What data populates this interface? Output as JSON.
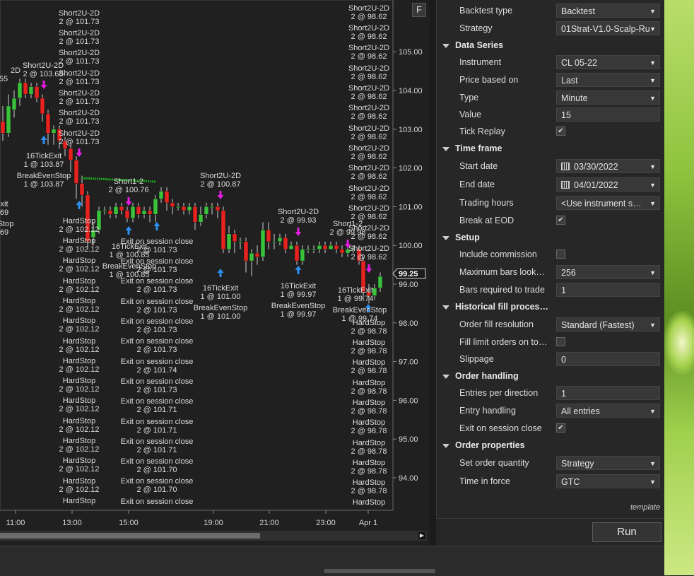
{
  "chart": {
    "button_f": "F",
    "y_ticks": [
      "105.00",
      "104.00",
      "103.00",
      "102.00",
      "101.00",
      "100.00",
      "99.00",
      "98.00",
      "97.00",
      "96.00",
      "95.00",
      "94.00"
    ],
    "x_ticks": [
      "11:00",
      "13:00",
      "15:00",
      "19:00",
      "21:00",
      "23:00",
      "Apr 1"
    ],
    "price_marker": "99.25",
    "annotations": [
      {
        "t": "2D",
        "x": 22,
        "y": 103
      },
      {
        "t": "55",
        "x": 5,
        "y": 115
      },
      {
        "t": "Short2U-2D",
        "x": 61,
        "y": 96
      },
      {
        "t": "2 @ 103.68",
        "x": 61,
        "y": 108
      },
      {
        "t": "16TickExit",
        "x": 62,
        "y": 224
      },
      {
        "t": "1 @ 103.87",
        "x": 62,
        "y": 236
      },
      {
        "t": "BreakEvenStop",
        "x": 62,
        "y": 252
      },
      {
        "t": "1 @ 103.87",
        "x": 62,
        "y": 264
      },
      {
        "t": "xit",
        "x": 6,
        "y": 292
      },
      {
        "t": "69",
        "x": 6,
        "y": 304
      },
      {
        "t": "Stop",
        "x": 8,
        "y": 320
      },
      {
        "t": "69",
        "x": 6,
        "y": 332
      },
      {
        "t": "Short2U-2D",
        "x": 112,
        "y": 22
      },
      {
        "t": "2 @ 101.73",
        "x": 112,
        "y": 34
      },
      {
        "t": "Short2U-2D",
        "x": 112,
        "y": 50
      },
      {
        "t": "2 @ 101.73",
        "x": 112,
        "y": 62
      },
      {
        "t": "Short2U-2D",
        "x": 112,
        "y": 78
      },
      {
        "t": "2 @ 101.73",
        "x": 112,
        "y": 90
      },
      {
        "t": "Short2U-2D",
        "x": 112,
        "y": 107
      },
      {
        "t": "2 @ 101.73",
        "x": 112,
        "y": 119
      },
      {
        "t": "Short2U-2D",
        "x": 112,
        "y": 135
      },
      {
        "t": "2 @ 101.73",
        "x": 112,
        "y": 147
      },
      {
        "t": "Short2U-2D",
        "x": 112,
        "y": 163
      },
      {
        "t": "2 @ 101.73",
        "x": 112,
        "y": 175
      },
      {
        "t": "Short2U-2D",
        "x": 112,
        "y": 192
      },
      {
        "t": "2 @ 101.73",
        "x": 112,
        "y": 204
      },
      {
        "t": "HardStop",
        "x": 112,
        "y": 316
      },
      {
        "t": "2 @ 102.12",
        "x": 112,
        "y": 328
      },
      {
        "t": "HardStop",
        "x": 112,
        "y": 344
      },
      {
        "t": "2 @ 102.12",
        "x": 112,
        "y": 356
      },
      {
        "t": "HardStop",
        "x": 112,
        "y": 372
      },
      {
        "t": "2 @ 102.12",
        "x": 112,
        "y": 384
      },
      {
        "t": "HardStop",
        "x": 112,
        "y": 401
      },
      {
        "t": "2 @ 102.12",
        "x": 112,
        "y": 413
      },
      {
        "t": "HardStop",
        "x": 112,
        "y": 429
      },
      {
        "t": "2 @ 102.12",
        "x": 112,
        "y": 441
      },
      {
        "t": "HardStop",
        "x": 112,
        "y": 457
      },
      {
        "t": "2 @ 102.12",
        "x": 112,
        "y": 469
      },
      {
        "t": "HardStop",
        "x": 112,
        "y": 486
      },
      {
        "t": "2 @ 102.12",
        "x": 112,
        "y": 498
      },
      {
        "t": "HardStop",
        "x": 112,
        "y": 514
      },
      {
        "t": "2 @ 102.12",
        "x": 112,
        "y": 526
      },
      {
        "t": "HardStop",
        "x": 112,
        "y": 542
      },
      {
        "t": "2 @ 102.12",
        "x": 112,
        "y": 554
      },
      {
        "t": "HardStop",
        "x": 112,
        "y": 570
      },
      {
        "t": "2 @ 102.12",
        "x": 112,
        "y": 582
      },
      {
        "t": "HardStop",
        "x": 112,
        "y": 599
      },
      {
        "t": "2 @ 102.12",
        "x": 112,
        "y": 611
      },
      {
        "t": "HardStop",
        "x": 112,
        "y": 627
      },
      {
        "t": "2 @ 102.12",
        "x": 112,
        "y": 639
      },
      {
        "t": "HardStop",
        "x": 112,
        "y": 655
      },
      {
        "t": "2 @ 102.12",
        "x": 112,
        "y": 667
      },
      {
        "t": "HardStop",
        "x": 112,
        "y": 684
      },
      {
        "t": "2 @ 102.12",
        "x": 112,
        "y": 696
      },
      {
        "t": "HardStop",
        "x": 112,
        "y": 712
      },
      {
        "t": "Short1-2",
        "x": 182,
        "y": 260
      },
      {
        "t": "2 @ 100.76",
        "x": 182,
        "y": 272
      },
      {
        "t": "16TickExit",
        "x": 183,
        "y": 352
      },
      {
        "t": "1 @ 100.85",
        "x": 183,
        "y": 364
      },
      {
        "t": "BreakEvenStop",
        "x": 183,
        "y": 380
      },
      {
        "t": "1 @ 100.85",
        "x": 183,
        "y": 392
      },
      {
        "t": "Exit on session close",
        "x": 222,
        "y": 345
      },
      {
        "t": "2 @ 101.73",
        "x": 222,
        "y": 357
      },
      {
        "t": "Exit on session close",
        "x": 222,
        "y": 373
      },
      {
        "t": "2 @ 101.73",
        "x": 222,
        "y": 385
      },
      {
        "t": "Exit on session close",
        "x": 222,
        "y": 401
      },
      {
        "t": "2 @ 101.73",
        "x": 222,
        "y": 413
      },
      {
        "t": "Exit on session close",
        "x": 222,
        "y": 430
      },
      {
        "t": "2 @ 101.73",
        "x": 222,
        "y": 442
      },
      {
        "t": "Exit on session close",
        "x": 222,
        "y": 458
      },
      {
        "t": "2 @ 101.73",
        "x": 222,
        "y": 470
      },
      {
        "t": "Exit on session close",
        "x": 222,
        "y": 486
      },
      {
        "t": "2 @ 101.73",
        "x": 222,
        "y": 498
      },
      {
        "t": "Exit on session close",
        "x": 222,
        "y": 515
      },
      {
        "t": "2 @ 101.74",
        "x": 222,
        "y": 527
      },
      {
        "t": "Exit on session close",
        "x": 222,
        "y": 543
      },
      {
        "t": "2 @ 101.73",
        "x": 222,
        "y": 555
      },
      {
        "t": "Exit on session close",
        "x": 222,
        "y": 571
      },
      {
        "t": "2 @ 101.71",
        "x": 222,
        "y": 583
      },
      {
        "t": "Exit on session close",
        "x": 222,
        "y": 600
      },
      {
        "t": "2 @ 101.71",
        "x": 222,
        "y": 612
      },
      {
        "t": "Exit on session close",
        "x": 222,
        "y": 628
      },
      {
        "t": "2 @ 101.71",
        "x": 222,
        "y": 640
      },
      {
        "t": "Exit on session close",
        "x": 222,
        "y": 656
      },
      {
        "t": "2 @ 101.70",
        "x": 222,
        "y": 668
      },
      {
        "t": "Exit on session close",
        "x": 222,
        "y": 684
      },
      {
        "t": "2 @ 101.70",
        "x": 222,
        "y": 696
      },
      {
        "t": "Exit on session close",
        "x": 222,
        "y": 713
      },
      {
        "t": "Short2U-2D",
        "x": 312,
        "y": 252
      },
      {
        "t": "2 @ 100.87",
        "x": 312,
        "y": 264
      },
      {
        "t": "16TickExit",
        "x": 312,
        "y": 411
      },
      {
        "t": "1 @ 101.00",
        "x": 312,
        "y": 423
      },
      {
        "t": "BreakEvenStop",
        "x": 312,
        "y": 439
      },
      {
        "t": "1 @ 101.00",
        "x": 312,
        "y": 451
      },
      {
        "t": "Short2U-2D",
        "x": 422,
        "y": 303
      },
      {
        "t": "2 @ 99.93",
        "x": 422,
        "y": 315
      },
      {
        "t": "16TickExit",
        "x": 422,
        "y": 408
      },
      {
        "t": "1 @ 99.97",
        "x": 422,
        "y": 420
      },
      {
        "t": "BreakEvenStop",
        "x": 422,
        "y": 436
      },
      {
        "t": "1 @ 99.97",
        "x": 422,
        "y": 448
      },
      {
        "t": "Short1-2",
        "x": 492,
        "y": 320
      },
      {
        "t": "2 @ 99.98",
        "x": 492,
        "y": 332
      },
      {
        "t": "16TickExit",
        "x": 503,
        "y": 414
      },
      {
        "t": "1 @ 99.74",
        "x": 503,
        "y": 426
      },
      {
        "t": "BreakEvenStop",
        "x": 509,
        "y": 442
      },
      {
        "t": "1 @ 99.74",
        "x": 509,
        "y": 454
      },
      {
        "t": "Short2U-2D",
        "x": 522,
        "y": 15
      },
      {
        "t": "2 @ 98.62",
        "x": 522,
        "y": 27
      },
      {
        "t": "Short2U-2D",
        "x": 522,
        "y": 43
      },
      {
        "t": "2 @ 98.62",
        "x": 522,
        "y": 55
      },
      {
        "t": "Short2U-2D",
        "x": 522,
        "y": 71
      },
      {
        "t": "2 @ 98.62",
        "x": 522,
        "y": 83
      },
      {
        "t": "Short2U-2D",
        "x": 522,
        "y": 100
      },
      {
        "t": "2 @ 98.62",
        "x": 522,
        "y": 112
      },
      {
        "t": "Short2U-2D",
        "x": 522,
        "y": 128
      },
      {
        "t": "2 @ 98.62",
        "x": 522,
        "y": 140
      },
      {
        "t": "Short2U-2D",
        "x": 522,
        "y": 156
      },
      {
        "t": "2 @ 98.62",
        "x": 522,
        "y": 168
      },
      {
        "t": "Short2U-2D",
        "x": 522,
        "y": 185
      },
      {
        "t": "2 @ 98.62",
        "x": 522,
        "y": 197
      },
      {
        "t": "Short2U-2D",
        "x": 522,
        "y": 213
      },
      {
        "t": "2 @ 98.62",
        "x": 522,
        "y": 225
      },
      {
        "t": "Short2U-2D",
        "x": 522,
        "y": 241
      },
      {
        "t": "2 @ 98.62",
        "x": 522,
        "y": 253
      },
      {
        "t": "Short2U-2D",
        "x": 522,
        "y": 270
      },
      {
        "t": "2 @ 98.62",
        "x": 522,
        "y": 282
      },
      {
        "t": "Short2U-2D",
        "x": 522,
        "y": 298
      },
      {
        "t": "2 @ 98.62",
        "x": 522,
        "y": 310
      },
      {
        "t": "Short2U-2D",
        "x": 522,
        "y": 326
      },
      {
        "t": "2 @ 98.62",
        "x": 522,
        "y": 338
      },
      {
        "t": "Short2U-2D",
        "x": 522,
        "y": 355
      },
      {
        "t": "2 @ 98.62",
        "x": 522,
        "y": 367
      },
      {
        "t": "HardStop",
        "x": 522,
        "y": 460
      },
      {
        "t": "2 @ 98.78",
        "x": 522,
        "y": 472
      },
      {
        "t": "HardStop",
        "x": 522,
        "y": 488
      },
      {
        "t": "2 @ 98.78",
        "x": 522,
        "y": 500
      },
      {
        "t": "HardStop",
        "x": 522,
        "y": 516
      },
      {
        "t": "2 @ 98.78",
        "x": 522,
        "y": 528
      },
      {
        "t": "HardStop",
        "x": 522,
        "y": 545
      },
      {
        "t": "2 @ 98.78",
        "x": 522,
        "y": 557
      },
      {
        "t": "HardStop",
        "x": 522,
        "y": 573
      },
      {
        "t": "2 @ 98.78",
        "x": 522,
        "y": 585
      },
      {
        "t": "HardStop",
        "x": 522,
        "y": 601
      },
      {
        "t": "2 @ 98.78",
        "x": 522,
        "y": 613
      },
      {
        "t": "HardStop",
        "x": 522,
        "y": 630
      },
      {
        "t": "2 @ 98.78",
        "x": 522,
        "y": 642
      },
      {
        "t": "HardStop",
        "x": 522,
        "y": 658
      },
      {
        "t": "2 @ 98.78",
        "x": 522,
        "y": 670
      },
      {
        "t": "HardStop",
        "x": 522,
        "y": 686
      },
      {
        "t": "2 @ 98.78",
        "x": 522,
        "y": 698
      },
      {
        "t": "HardStop",
        "x": 522,
        "y": 714
      }
    ]
  },
  "panel": {
    "rows": [
      {
        "kind": "prop",
        "label": "Backtest type",
        "value": "Backtest",
        "ctrl": "select"
      },
      {
        "kind": "prop",
        "label": "Strategy",
        "value": "01Strat-V1.0-Scalp-Ru",
        "ctrl": "select"
      },
      {
        "kind": "cat",
        "label": "Data Series"
      },
      {
        "kind": "prop",
        "label": "Instrument",
        "value": "CL 05-22",
        "ctrl": "select"
      },
      {
        "kind": "prop",
        "label": "Price based on",
        "value": "Last",
        "ctrl": "select"
      },
      {
        "kind": "prop",
        "label": "Type",
        "value": "Minute",
        "ctrl": "select"
      },
      {
        "kind": "prop",
        "label": "Value",
        "value": "15",
        "ctrl": "input"
      },
      {
        "kind": "prop",
        "label": "Tick Replay",
        "value": "✔",
        "ctrl": "check"
      },
      {
        "kind": "cat",
        "label": "Time frame"
      },
      {
        "kind": "prop",
        "label": "Start date",
        "value": "03/30/2022",
        "ctrl": "date"
      },
      {
        "kind": "prop",
        "label": "End date",
        "value": "04/01/2022",
        "ctrl": "date"
      },
      {
        "kind": "prop",
        "label": "Trading hours",
        "value": "<Use instrument s…",
        "ctrl": "select"
      },
      {
        "kind": "prop",
        "label": "Break at EOD",
        "value": "✔",
        "ctrl": "check"
      },
      {
        "kind": "cat",
        "label": "Setup"
      },
      {
        "kind": "prop",
        "label": "Include commission",
        "value": "",
        "ctrl": "check"
      },
      {
        "kind": "prop",
        "label": "Maximum bars look…",
        "value": "256",
        "ctrl": "select"
      },
      {
        "kind": "prop",
        "label": "Bars required to trade",
        "value": "1",
        "ctrl": "input"
      },
      {
        "kind": "cat",
        "label": "Historical fill proces…"
      },
      {
        "kind": "prop",
        "label": "Order fill resolution",
        "value": "Standard (Fastest)",
        "ctrl": "select"
      },
      {
        "kind": "prop",
        "label": "Fill limit orders on to…",
        "value": "",
        "ctrl": "check"
      },
      {
        "kind": "prop",
        "label": "Slippage",
        "value": "0",
        "ctrl": "input"
      },
      {
        "kind": "cat",
        "label": "Order handling"
      },
      {
        "kind": "prop",
        "label": "Entries per direction",
        "value": "1",
        "ctrl": "input"
      },
      {
        "kind": "prop",
        "label": "Entry handling",
        "value": "All entries",
        "ctrl": "select"
      },
      {
        "kind": "prop",
        "label": "Exit on session close",
        "value": "✔",
        "ctrl": "check"
      },
      {
        "kind": "cat",
        "label": "Order properties"
      },
      {
        "kind": "prop",
        "label": "Set order quantity",
        "value": "Strategy",
        "ctrl": "select"
      },
      {
        "kind": "prop",
        "label": "Time in force",
        "value": "GTC",
        "ctrl": "select"
      }
    ],
    "template_label": "template",
    "run_label": "Run"
  },
  "colors": {
    "bull": "#39c23a",
    "bear": "#e8231f",
    "entry_arrow": "#e51ce0",
    "exit_arrow": "#2d8ff0",
    "text": "#dcdcdc"
  }
}
